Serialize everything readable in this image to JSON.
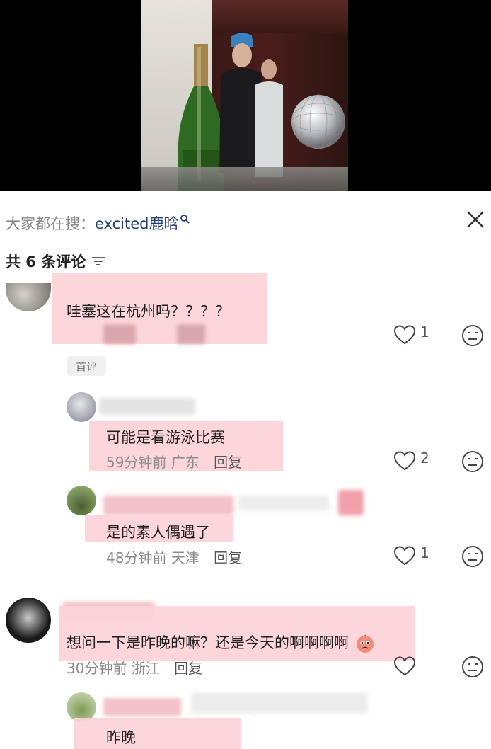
{
  "header": {
    "search_prefix": "大家都在搜：",
    "search_term": "excited鹿晗",
    "comment_count_label": "共 6 条评论"
  },
  "comments": [
    {
      "text": "哇塞这在杭州吗？？？？",
      "meta_blurred": "回复",
      "tag": "首评",
      "likes": "1"
    },
    {
      "text": "可能是看游泳比赛",
      "time": "59分钟前",
      "location": "广东",
      "reply": "回复",
      "likes": "2"
    },
    {
      "text": "是的素人偶遇了",
      "time": "48分钟前",
      "location": "天津",
      "reply": "回复",
      "likes": "1"
    },
    {
      "text": "想问一下是昨晚的嘛？还是今天的啊啊啊啊",
      "time": "30分钟前",
      "location": "浙江",
      "reply": "回复",
      "likes": ""
    },
    {
      "text": "昨晚"
    }
  ],
  "colors": {
    "highlight": "#fcd3d8",
    "search_term": "#24406e",
    "meta": "#8b8b8b"
  },
  "icons": [
    "search-icon",
    "close-icon",
    "sort-icon",
    "heart-icon",
    "emoji-icon"
  ]
}
